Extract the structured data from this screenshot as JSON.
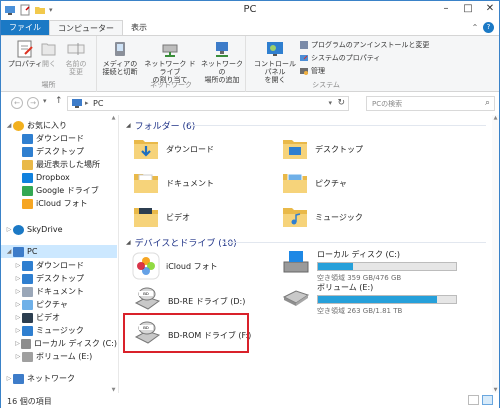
{
  "window": {
    "title": "PC"
  },
  "ribbon": {
    "tabs": [
      "ファイル",
      "コンピューター",
      "表示"
    ],
    "groups": {
      "location": {
        "label": "場所",
        "buttons": [
          "プロパティ",
          "開く",
          "名前の\n変更"
        ]
      },
      "network": {
        "label": "ネットワーク",
        "buttons": [
          "メディアの\n接続と切断",
          "ネットワーク ドライブ\nの割り当て",
          "ネットワークの\n場所の追加"
        ]
      },
      "system": {
        "label": "システム",
        "open_control_panel": "コントロール パネル\nを開く",
        "small_buttons": [
          "プログラムのアンインストールと変更",
          "システムのプロパティ",
          "管理"
        ]
      }
    }
  },
  "address": {
    "path": "PC",
    "search_placeholder": "PCの検索"
  },
  "sidebar": {
    "items": [
      {
        "label": "お気に入り",
        "icon": "star-icon",
        "level": 0,
        "expand": "◢"
      },
      {
        "label": "ダウンロード",
        "icon": "download-folder-icon",
        "level": 1
      },
      {
        "label": "デスクトップ",
        "icon": "desktop-icon",
        "level": 1
      },
      {
        "label": "最近表示した場所",
        "icon": "recent-places-icon",
        "level": 1
      },
      {
        "label": "Dropbox",
        "icon": "dropbox-icon",
        "level": 1
      },
      {
        "label": "Google ドライブ",
        "icon": "google-drive-icon",
        "level": 1
      },
      {
        "label": "iCloud フォト",
        "icon": "icloud-photos-icon",
        "level": 1
      },
      {
        "label": "SkyDrive",
        "icon": "skydrive-icon",
        "level": 0,
        "expand": "▷"
      },
      {
        "label": "PC",
        "icon": "pc-icon",
        "level": 0,
        "expand": "◢",
        "selected": true
      },
      {
        "label": "ダウンロード",
        "icon": "download-folder-icon",
        "level": 1,
        "expand": "▷"
      },
      {
        "label": "デスクトップ",
        "icon": "desktop-icon",
        "level": 1,
        "expand": "▷"
      },
      {
        "label": "ドキュメント",
        "icon": "documents-icon",
        "level": 1,
        "expand": "▷"
      },
      {
        "label": "ピクチャ",
        "icon": "pictures-icon",
        "level": 1,
        "expand": "▷"
      },
      {
        "label": "ビデオ",
        "icon": "videos-icon",
        "level": 1,
        "expand": "▷"
      },
      {
        "label": "ミュージック",
        "icon": "music-icon",
        "level": 1,
        "expand": "▷"
      },
      {
        "label": "ローカル ディスク (C:)",
        "icon": "local-disk-icon",
        "level": 1,
        "expand": "▷"
      },
      {
        "label": "ボリューム (E:)",
        "icon": "volume-icon",
        "level": 1,
        "expand": "▷"
      },
      {
        "label": "ネットワーク",
        "icon": "network-icon",
        "level": 0,
        "expand": "▷"
      }
    ]
  },
  "main": {
    "folders_section": "フォルダー (6)",
    "folders": [
      {
        "label": "ダウンロード",
        "icon": "download-folder-icon"
      },
      {
        "label": "デスクトップ",
        "icon": "desktop-folder-icon"
      },
      {
        "label": "ドキュメント",
        "icon": "documents-folder-icon"
      },
      {
        "label": "ピクチャ",
        "icon": "pictures-folder-icon"
      },
      {
        "label": "ビデオ",
        "icon": "videos-folder-icon"
      },
      {
        "label": "ミュージック",
        "icon": "music-folder-icon"
      }
    ],
    "devices_section": "デバイスとドライブ (10)",
    "devices": [
      {
        "label": "iCloud フォト",
        "icon": "icloud-photos-icon"
      },
      {
        "label": "ローカル ディスク (C:)",
        "icon": "windows-drive-icon",
        "free": "空き領域 359 GB/476 GB",
        "used_fraction": 0.25
      },
      {
        "label": "BD-RE ドライブ (D:)",
        "icon": "bd-re-drive-icon"
      },
      {
        "label": "ボリューム (E:)",
        "icon": "hard-drive-icon",
        "free": "空き領域 263 GB/1.81 TB",
        "used_fraction": 0.86
      },
      {
        "label": "BD-ROM ドライブ (F:)",
        "icon": "bd-rom-drive-icon"
      }
    ]
  },
  "status": {
    "count": "16 個の項目"
  },
  "colors": {
    "accent": "#1b79c5",
    "selection": "#cce8ff",
    "highlight": "#d9212a",
    "bar_fill": "#26a0da"
  }
}
